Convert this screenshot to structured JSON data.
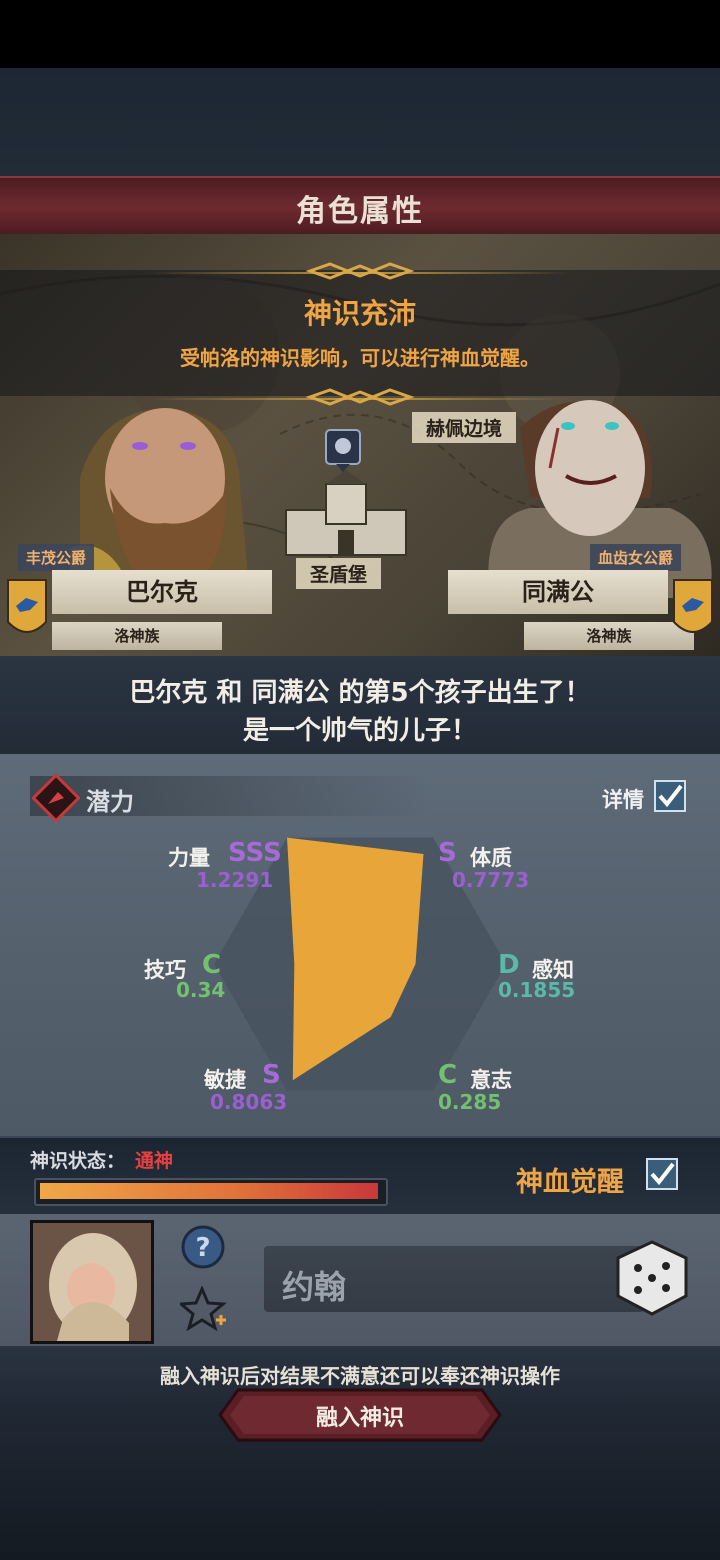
{
  "header": {
    "title": "角色属性"
  },
  "banner": {
    "title": "神识充沛",
    "subtitle": "受帕洛的神识影响，可以进行神血觉醒。"
  },
  "map": {
    "location_top": "赫佩边境",
    "location_castle": "圣盾堡"
  },
  "parents": {
    "father": {
      "title": "丰茂公爵",
      "name": "巴尔克",
      "clan": "洛神族"
    },
    "mother": {
      "title": "血齿女公爵",
      "name": "同满公",
      "clan": "洛神族"
    }
  },
  "birth": {
    "line1": "巴尔克 和 同满公 的第5个孩子出生了！",
    "line2": "是一个帅气的儿子！"
  },
  "potential": {
    "section_label": "潜力",
    "detail_label": "详情",
    "detail_checked": true,
    "stats": [
      {
        "name": "力量",
        "grade": "SSS",
        "value": "1.2291",
        "grade_color": "#a86ad8",
        "value_color": "#9a5fd0",
        "radar": 1.0
      },
      {
        "name": "体质",
        "grade": "S",
        "value": "0.7773",
        "grade_color": "#a86ad8",
        "value_color": "#9a5fd0",
        "radar": 0.87
      },
      {
        "name": "感知",
        "grade": "D",
        "value": "0.1855",
        "grade_color": "#5cb8a8",
        "value_color": "#5cb8a8",
        "radar": 0.38
      },
      {
        "name": "意志",
        "grade": "C",
        "value": "0.285",
        "grade_color": "#72c070",
        "value_color": "#72c070",
        "radar": 0.42
      },
      {
        "name": "敏捷",
        "grade": "S",
        "value": "0.8063",
        "grade_color": "#a86ad8",
        "value_color": "#9a5fd0",
        "radar": 0.92
      },
      {
        "name": "技巧",
        "grade": "C",
        "value": "0.34",
        "grade_color": "#72c070",
        "value_color": "#72c070",
        "radar": 0.45
      }
    ]
  },
  "divine_state": {
    "label": "神识状态：",
    "value": "通神",
    "progress": 1.0
  },
  "awakening": {
    "label": "神血觉醒",
    "checked": true
  },
  "child": {
    "name": "约翰"
  },
  "footer": {
    "hint": "融入神识后对结果不满意还可以奉还神识操作",
    "button_label": "融入神识"
  },
  "colors": {
    "accent_orange": "#f0a545",
    "radar_fill": "#e8a63a",
    "danger_red": "#e84040"
  }
}
